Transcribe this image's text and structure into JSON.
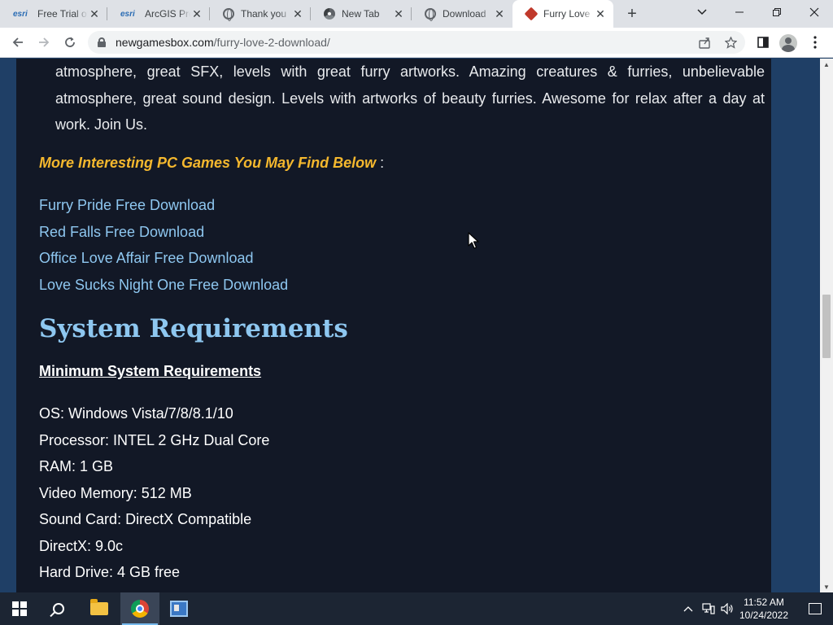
{
  "browser": {
    "tabs": [
      {
        "favicon": "esri-icon",
        "title": "Free Trial of"
      },
      {
        "favicon": "esri-icon",
        "title": "ArcGIS Pro"
      },
      {
        "favicon": "globe-icon",
        "title": "Thank you"
      },
      {
        "favicon": "chrome-icon",
        "title": "New Tab"
      },
      {
        "favicon": "globe-icon",
        "title": "Download"
      },
      {
        "favicon": "game-cube-icon",
        "title": "Furry Love",
        "active": true
      }
    ],
    "favicon_text": "esri",
    "close_glyph": "✕",
    "new_tab_glyph": "+",
    "url_host": "newgamesbox.com",
    "url_path": "/furry-love-2-download/"
  },
  "page": {
    "description_lines": [
      "atmosphere, great SFX, levels with great furry artworks. Amazing creatures & furries, unbelievable",
      "atmosphere, great sound design. Levels with artworks of beauty furries. Awesome for relax after a day at",
      "work. Join Us."
    ],
    "more_games_heading": "More Interesting PC Games You May Find Below",
    "more_games_suffix": " :",
    "related_games": [
      "Furry Pride Free Download",
      "Red Falls Free Download",
      "Office Love Affair Free Download",
      "Love Sucks Night One Free Download"
    ],
    "system_requirements_title": "System Requirements",
    "minimum_title": "Minimum System Requirements",
    "requirements": [
      "OS: Windows Vista/7/8/8.1/10",
      "Processor: INTEL 2 GHz Dual Core",
      "RAM: 1 GB",
      "Video Memory: 512 MB",
      "Sound Card: DirectX Compatible",
      "DirectX: 9.0c",
      "Hard Drive: 4 GB free"
    ]
  },
  "taskbar": {
    "apps": [
      "windows-start-icon",
      "search-icon",
      "file-explorer-icon",
      "chrome-icon",
      "app-icon"
    ],
    "active_app": "chrome-icon",
    "time": "11:52 AM",
    "date": "10/24/2022"
  },
  "colors": {
    "page_background": "#1f3f66",
    "content_background": "#121826",
    "link": "#8ec7f0",
    "highlight": "#f5b82e"
  }
}
